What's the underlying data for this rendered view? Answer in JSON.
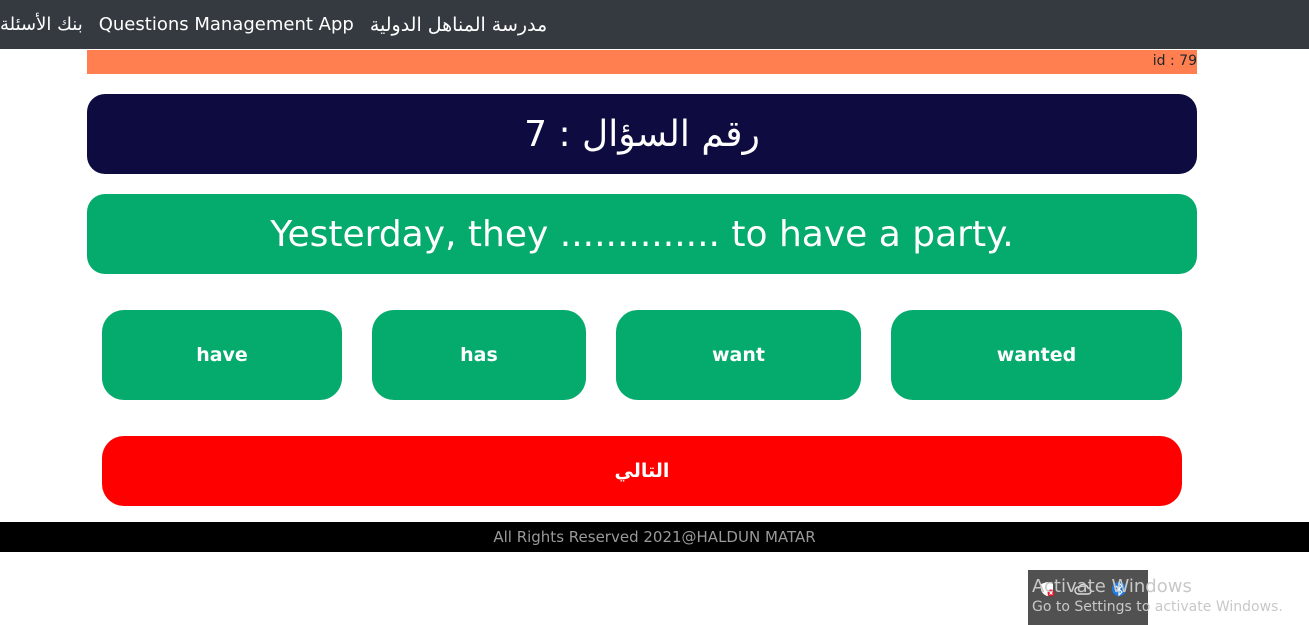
{
  "navbar": {
    "brand": "مدرسة المناهل الدولية",
    "app_link": "Questions Management App",
    "bank_link": "بنك الأسئلة"
  },
  "id_label": "id : 79",
  "question_number": "رقم السؤال : 7",
  "question_text": "Yesterday, they .............. to have a party.",
  "options": [
    {
      "label": "have"
    },
    {
      "label": "has"
    },
    {
      "label": "want"
    },
    {
      "label": "wanted"
    }
  ],
  "next_label": "التالي",
  "footer": "All Rights Reserved 2021@HALDUN MATAR",
  "watermark": {
    "title": "Activate Windows",
    "subtitle": "Go to Settings to activate Windows."
  },
  "tray_icons": [
    "security-shield-icon",
    "cloud-icon",
    "bluetooth-icon"
  ],
  "colors": {
    "navbar": "#343a40",
    "id_bar": "#ff7f50",
    "question_number_bg": "#0d0b3f",
    "question_bg": "#05aa6d",
    "option_bg": "#05aa6d",
    "next_bg": "#ff0000",
    "footer_bg": "#000000"
  }
}
